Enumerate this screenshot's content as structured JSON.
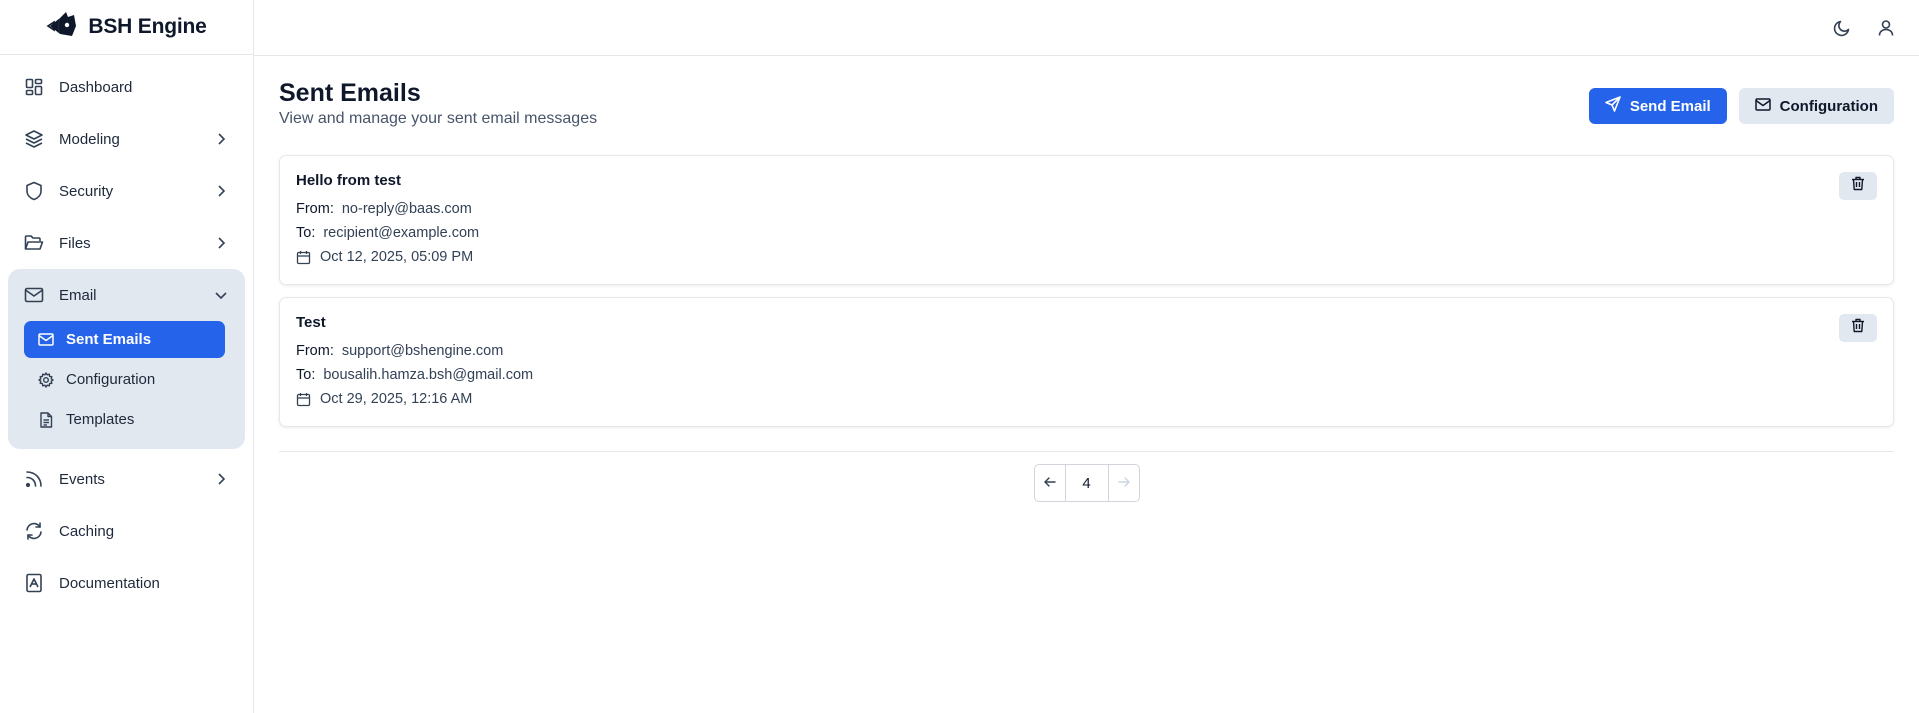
{
  "brand": {
    "name": "BSH Engine"
  },
  "sidebar": {
    "items": [
      {
        "label": "Dashboard"
      },
      {
        "label": "Modeling"
      },
      {
        "label": "Security"
      },
      {
        "label": "Files"
      },
      {
        "label": "Email"
      },
      {
        "label": "Events"
      },
      {
        "label": "Caching"
      },
      {
        "label": "Documentation"
      }
    ],
    "email_sub": [
      {
        "label": "Sent Emails"
      },
      {
        "label": "Configuration"
      },
      {
        "label": "Templates"
      }
    ]
  },
  "page": {
    "title": "Sent Emails",
    "subtitle": "View and manage your sent email messages",
    "send_label": "Send Email",
    "config_label": "Configuration"
  },
  "labels": {
    "from": "From:",
    "to": "To:"
  },
  "emails": [
    {
      "subject": "Hello from test",
      "from": "no-reply@baas.com",
      "to": "recipient@example.com",
      "date": "Oct 12, 2025, 05:09 PM"
    },
    {
      "subject": "Test",
      "from": "support@bshengine.com",
      "to": "bousalih.hamza.bsh@gmail.com",
      "date": "Oct 29, 2025, 12:16 AM"
    }
  ],
  "pagination": {
    "current": "4"
  },
  "colors": {
    "accent": "#2563eb",
    "muted_bg": "#e2e8f0",
    "border": "#e5e7eb"
  }
}
